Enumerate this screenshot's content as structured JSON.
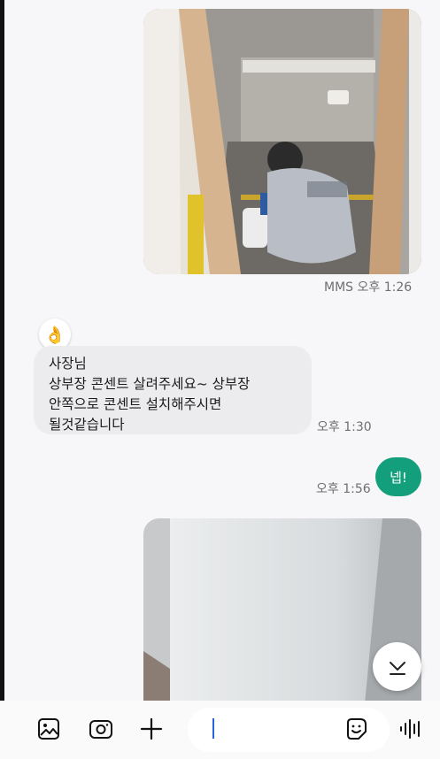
{
  "messages": {
    "mms_time": "MMS 오후 1:26",
    "incoming": {
      "avatar_emoji": "👌",
      "lines": [
        "사장님",
        "상부장 콘센트 살려주세요~ 상부장",
        "안쪽으로 콘센트 설치해주시면",
        "될것같습니다"
      ],
      "time": "오후 1:30"
    },
    "outgoing": {
      "text": "넵!",
      "time": "오후 1:56"
    }
  },
  "compose": {
    "icons": [
      "gallery-icon",
      "camera-icon",
      "plus-icon",
      "sticker-icon",
      "voice-icon"
    ]
  },
  "colors": {
    "outgoing_bubble": "#139f7c",
    "incoming_bubble": "#ececee",
    "cursor": "#2b62e0"
  }
}
